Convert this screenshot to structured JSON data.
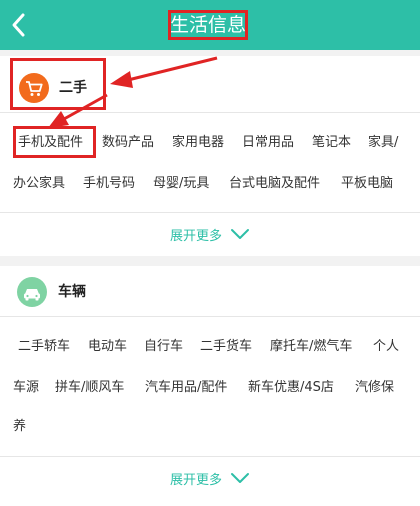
{
  "header": {
    "title": "生活信息",
    "back_icon": "chevron-left-icon",
    "bg_color": "#2dbfa7"
  },
  "sections": [
    {
      "name": "二手",
      "icon": "shopping-cart-icon",
      "icon_color": "#f26b1d",
      "items": [
        "手机及配件",
        "数码产品",
        "家用电器",
        "日常用品",
        "笔记本",
        "家具/",
        "办公家具",
        "手机号码",
        "母婴/玩具",
        "台式电脑及配件",
        "平板电脑"
      ],
      "expand_label": "展开更多"
    },
    {
      "name": "车辆",
      "icon": "car-icon",
      "icon_color": "#7fd3a3",
      "items": [
        "二手轿车",
        "电动车",
        "自行车",
        "二手货车",
        "摩托车/燃气车",
        "个人",
        "车源",
        "拼车/顺风车",
        "汽车用品/配件",
        "新车优惠/4S店",
        "汽修保",
        "养"
      ],
      "expand_label": "展开更多"
    }
  ],
  "annotation": {
    "highlight_color": "#e02424"
  }
}
